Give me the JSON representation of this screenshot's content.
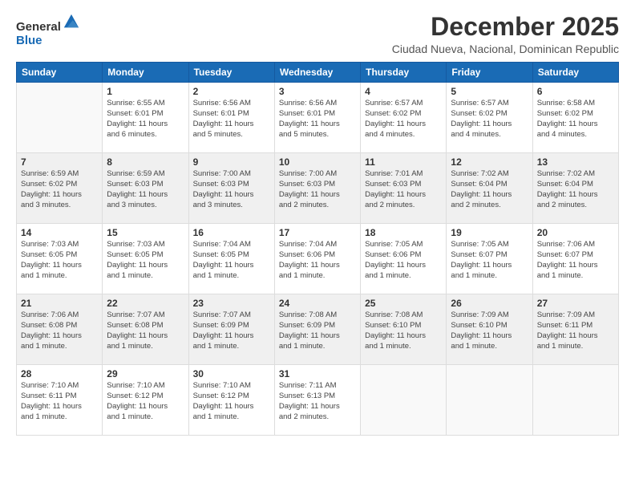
{
  "header": {
    "logo_general": "General",
    "logo_blue": "Blue",
    "month_title": "December 2025",
    "location": "Ciudad Nueva, Nacional, Dominican Republic"
  },
  "calendar": {
    "headers": [
      "Sunday",
      "Monday",
      "Tuesday",
      "Wednesday",
      "Thursday",
      "Friday",
      "Saturday"
    ],
    "weeks": [
      [
        {
          "day": "",
          "info": ""
        },
        {
          "day": "1",
          "info": "Sunrise: 6:55 AM\nSunset: 6:01 PM\nDaylight: 11 hours\nand 6 minutes."
        },
        {
          "day": "2",
          "info": "Sunrise: 6:56 AM\nSunset: 6:01 PM\nDaylight: 11 hours\nand 5 minutes."
        },
        {
          "day": "3",
          "info": "Sunrise: 6:56 AM\nSunset: 6:01 PM\nDaylight: 11 hours\nand 5 minutes."
        },
        {
          "day": "4",
          "info": "Sunrise: 6:57 AM\nSunset: 6:02 PM\nDaylight: 11 hours\nand 4 minutes."
        },
        {
          "day": "5",
          "info": "Sunrise: 6:57 AM\nSunset: 6:02 PM\nDaylight: 11 hours\nand 4 minutes."
        },
        {
          "day": "6",
          "info": "Sunrise: 6:58 AM\nSunset: 6:02 PM\nDaylight: 11 hours\nand 4 minutes."
        }
      ],
      [
        {
          "day": "7",
          "info": "Sunrise: 6:59 AM\nSunset: 6:02 PM\nDaylight: 11 hours\nand 3 minutes."
        },
        {
          "day": "8",
          "info": "Sunrise: 6:59 AM\nSunset: 6:03 PM\nDaylight: 11 hours\nand 3 minutes."
        },
        {
          "day": "9",
          "info": "Sunrise: 7:00 AM\nSunset: 6:03 PM\nDaylight: 11 hours\nand 3 minutes."
        },
        {
          "day": "10",
          "info": "Sunrise: 7:00 AM\nSunset: 6:03 PM\nDaylight: 11 hours\nand 2 minutes."
        },
        {
          "day": "11",
          "info": "Sunrise: 7:01 AM\nSunset: 6:03 PM\nDaylight: 11 hours\nand 2 minutes."
        },
        {
          "day": "12",
          "info": "Sunrise: 7:02 AM\nSunset: 6:04 PM\nDaylight: 11 hours\nand 2 minutes."
        },
        {
          "day": "13",
          "info": "Sunrise: 7:02 AM\nSunset: 6:04 PM\nDaylight: 11 hours\nand 2 minutes."
        }
      ],
      [
        {
          "day": "14",
          "info": "Sunrise: 7:03 AM\nSunset: 6:05 PM\nDaylight: 11 hours\nand 1 minute."
        },
        {
          "day": "15",
          "info": "Sunrise: 7:03 AM\nSunset: 6:05 PM\nDaylight: 11 hours\nand 1 minute."
        },
        {
          "day": "16",
          "info": "Sunrise: 7:04 AM\nSunset: 6:05 PM\nDaylight: 11 hours\nand 1 minute."
        },
        {
          "day": "17",
          "info": "Sunrise: 7:04 AM\nSunset: 6:06 PM\nDaylight: 11 hours\nand 1 minute."
        },
        {
          "day": "18",
          "info": "Sunrise: 7:05 AM\nSunset: 6:06 PM\nDaylight: 11 hours\nand 1 minute."
        },
        {
          "day": "19",
          "info": "Sunrise: 7:05 AM\nSunset: 6:07 PM\nDaylight: 11 hours\nand 1 minute."
        },
        {
          "day": "20",
          "info": "Sunrise: 7:06 AM\nSunset: 6:07 PM\nDaylight: 11 hours\nand 1 minute."
        }
      ],
      [
        {
          "day": "21",
          "info": "Sunrise: 7:06 AM\nSunset: 6:08 PM\nDaylight: 11 hours\nand 1 minute."
        },
        {
          "day": "22",
          "info": "Sunrise: 7:07 AM\nSunset: 6:08 PM\nDaylight: 11 hours\nand 1 minute."
        },
        {
          "day": "23",
          "info": "Sunrise: 7:07 AM\nSunset: 6:09 PM\nDaylight: 11 hours\nand 1 minute."
        },
        {
          "day": "24",
          "info": "Sunrise: 7:08 AM\nSunset: 6:09 PM\nDaylight: 11 hours\nand 1 minute."
        },
        {
          "day": "25",
          "info": "Sunrise: 7:08 AM\nSunset: 6:10 PM\nDaylight: 11 hours\nand 1 minute."
        },
        {
          "day": "26",
          "info": "Sunrise: 7:09 AM\nSunset: 6:10 PM\nDaylight: 11 hours\nand 1 minute."
        },
        {
          "day": "27",
          "info": "Sunrise: 7:09 AM\nSunset: 6:11 PM\nDaylight: 11 hours\nand 1 minute."
        }
      ],
      [
        {
          "day": "28",
          "info": "Sunrise: 7:10 AM\nSunset: 6:11 PM\nDaylight: 11 hours\nand 1 minute."
        },
        {
          "day": "29",
          "info": "Sunrise: 7:10 AM\nSunset: 6:12 PM\nDaylight: 11 hours\nand 1 minute."
        },
        {
          "day": "30",
          "info": "Sunrise: 7:10 AM\nSunset: 6:12 PM\nDaylight: 11 hours\nand 1 minute."
        },
        {
          "day": "31",
          "info": "Sunrise: 7:11 AM\nSunset: 6:13 PM\nDaylight: 11 hours\nand 2 minutes."
        },
        {
          "day": "",
          "info": ""
        },
        {
          "day": "",
          "info": ""
        },
        {
          "day": "",
          "info": ""
        }
      ]
    ]
  }
}
